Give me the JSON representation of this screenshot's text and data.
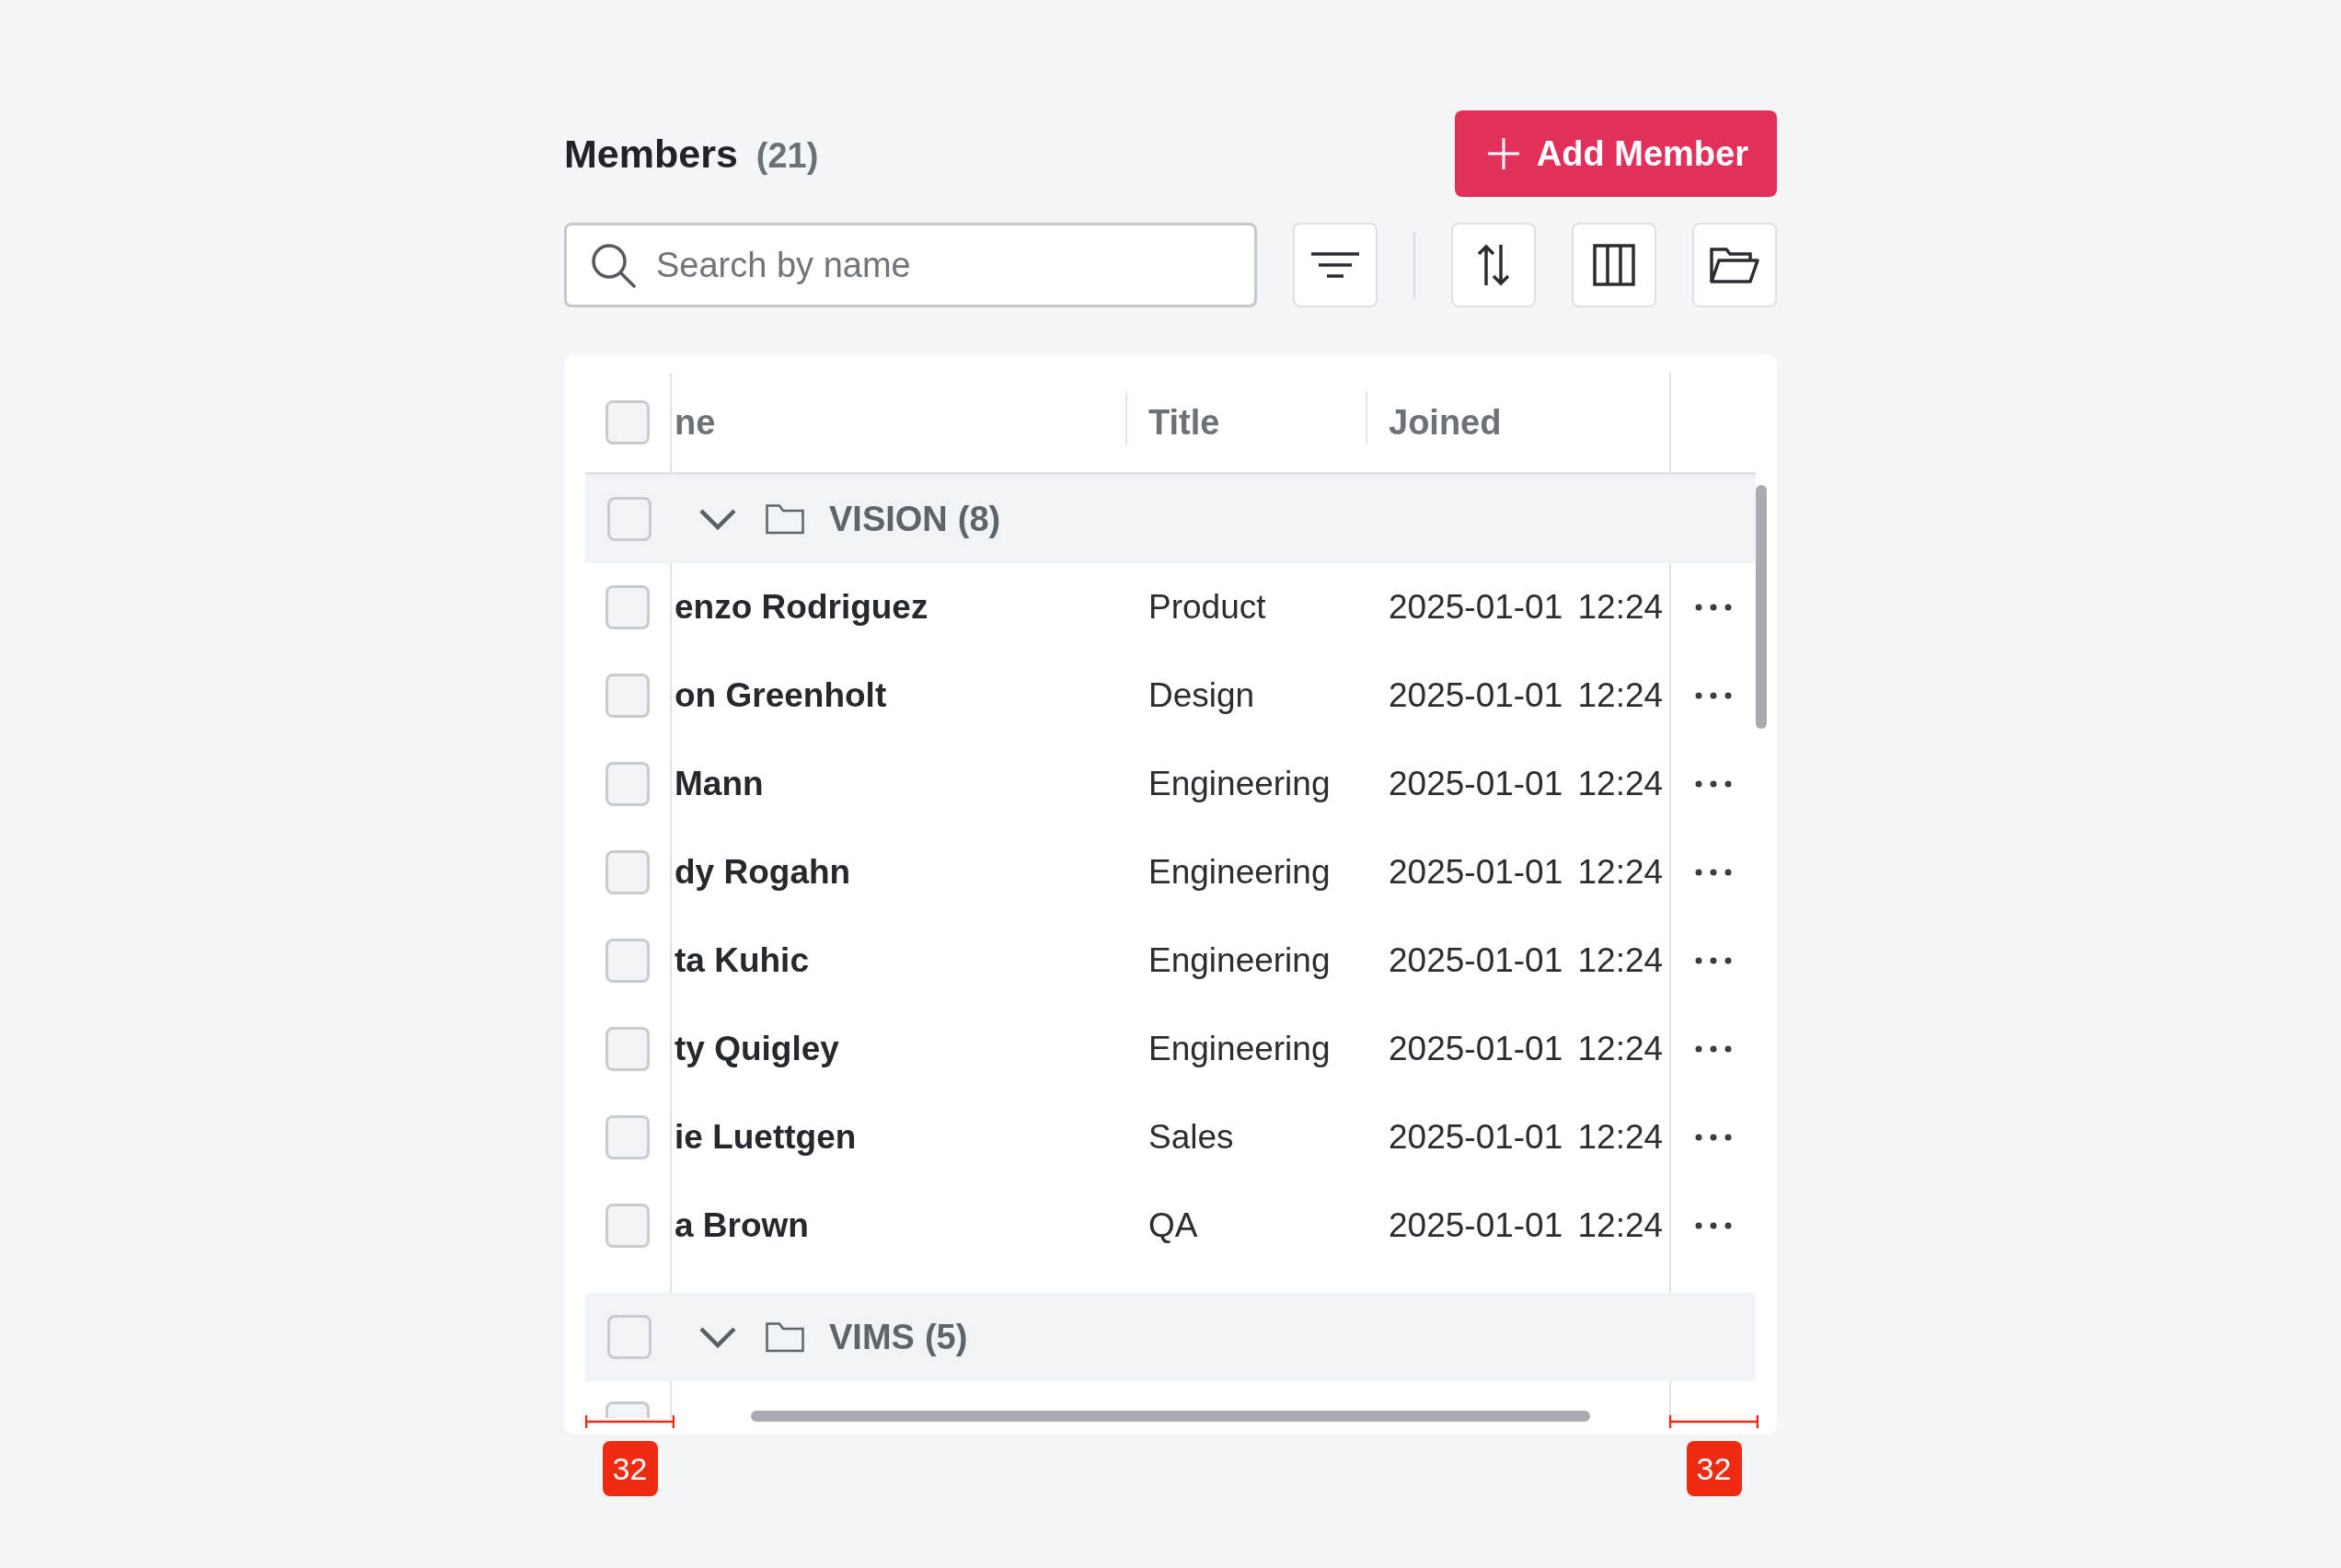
{
  "header": {
    "title": "Members",
    "count": "(21)",
    "add_button": {
      "label": "Add Member"
    }
  },
  "toolbar": {
    "search": {
      "placeholder": "Search by name"
    }
  },
  "table": {
    "select_all": {
      "checked": false
    },
    "columns": [
      {
        "label": "ne"
      },
      {
        "label": "Title"
      },
      {
        "label": "Joined"
      }
    ],
    "groups": [
      {
        "label": "VISION",
        "count": "(8)",
        "checked": false,
        "expanded": true,
        "rows": [
          {
            "checked": false,
            "name": "enzo Rodriguez",
            "title": "Product",
            "joined": "2025-01-01 12:24"
          },
          {
            "checked": false,
            "name": "on Greenholt",
            "title": "Design",
            "joined": "2025-01-01 12:24"
          },
          {
            "checked": false,
            "name": "Mann",
            "title": "Engineering",
            "joined": "2025-01-01 12:24"
          },
          {
            "checked": false,
            "name": "dy Rogahn",
            "title": "Engineering",
            "joined": "2025-01-01 12:24"
          },
          {
            "checked": false,
            "name": "ta Kuhic",
            "title": "Engineering",
            "joined": "2025-01-01 12:24"
          },
          {
            "checked": false,
            "name": "ty Quigley",
            "title": "Engineering",
            "joined": "2025-01-01 12:24"
          },
          {
            "checked": false,
            "name": "ie Luettgen",
            "title": "Sales",
            "joined": "2025-01-01 12:24"
          },
          {
            "checked": false,
            "name": "a Brown",
            "title": "QA",
            "joined": "2025-01-01 12:24"
          }
        ]
      },
      {
        "label": "VIMS",
        "count": "(5)",
        "checked": false,
        "expanded": true,
        "rows": [
          {
            "checked": false
          }
        ]
      }
    ]
  },
  "annotations": [
    {
      "label": "32"
    },
    {
      "label": "32"
    }
  ]
}
